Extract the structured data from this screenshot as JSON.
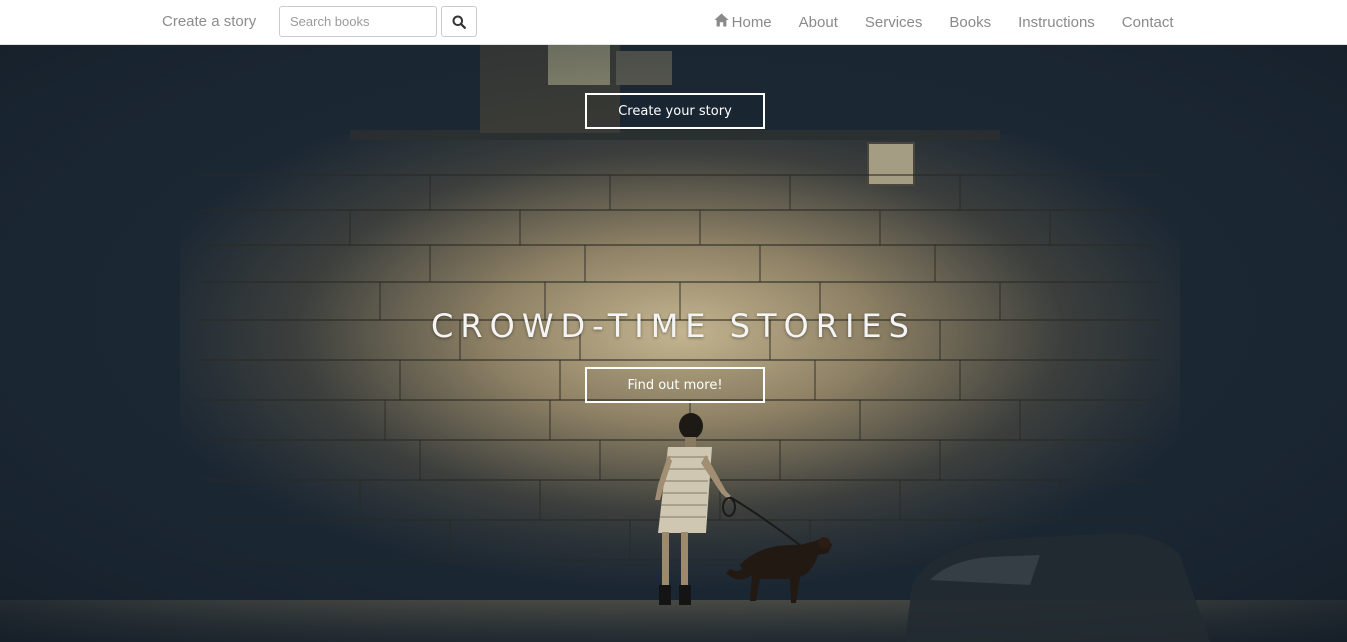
{
  "navbar": {
    "brand": "Create a story",
    "search": {
      "placeholder": "Search books",
      "value": ""
    },
    "search_button_icon": "search-icon",
    "links": [
      {
        "label": "Home",
        "icon": "home-icon"
      },
      {
        "label": "About"
      },
      {
        "label": "Services"
      },
      {
        "label": "Books"
      },
      {
        "label": "Instructions"
      },
      {
        "label": "Contact"
      }
    ]
  },
  "hero": {
    "create_button_label": "Create your story",
    "title": "CROWD-TIME STORIES",
    "find_button_label": "Find out more!",
    "background": "photo of a child walking a dog by a lit stone wall"
  },
  "colors": {
    "nav_background": "#ffffff",
    "nav_text": "#8a8a8a",
    "hero_dark": "#1b2733",
    "wall_light": "#b6a784",
    "button_border": "#ffffff"
  }
}
